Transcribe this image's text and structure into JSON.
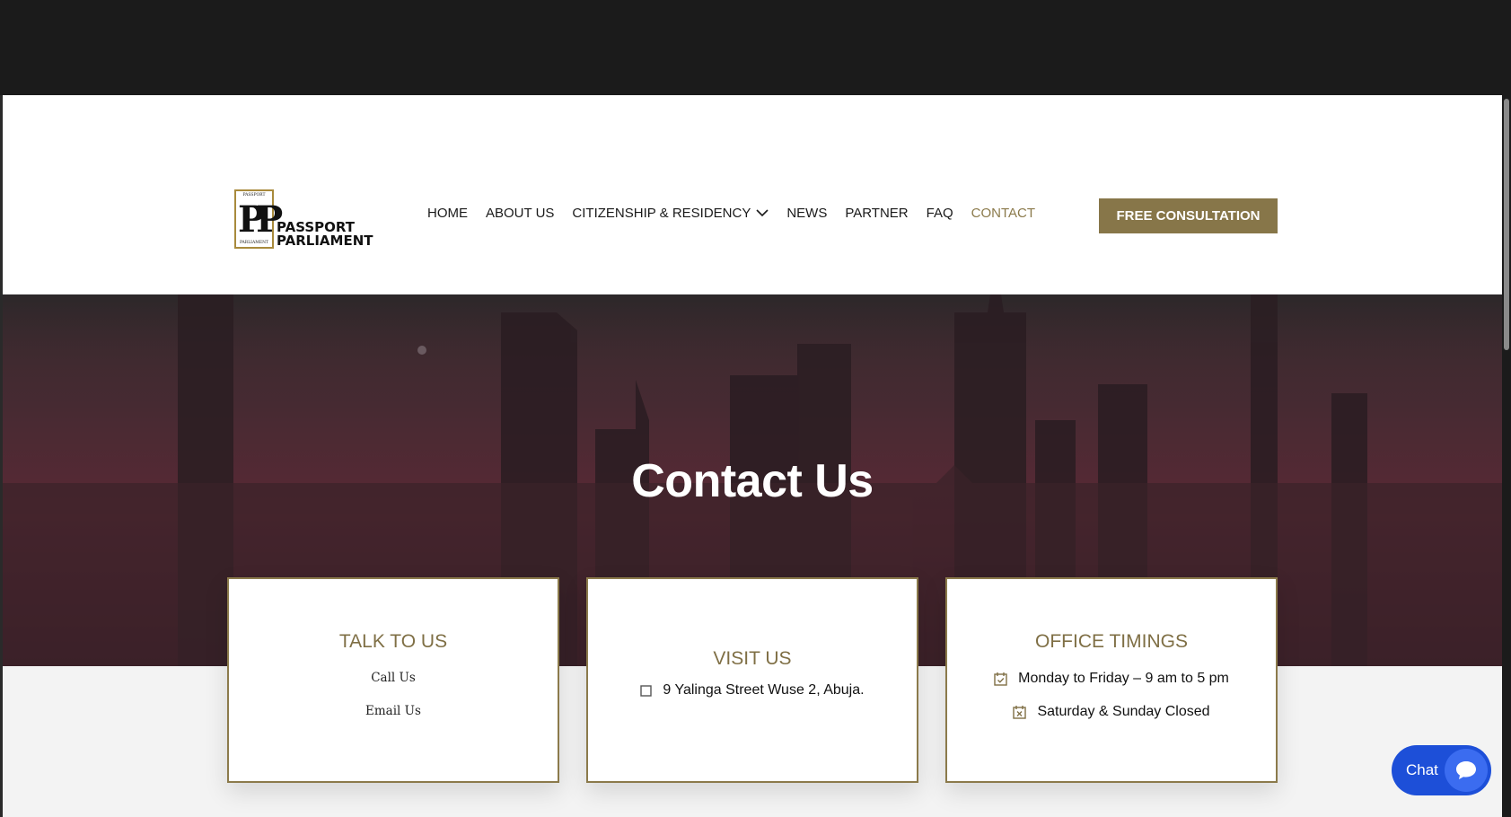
{
  "logo": {
    "top_text": "PASSPORT",
    "bottom_text": "PARLIAMENT",
    "mark": "PP",
    "line1": "PASSPORT",
    "line2": "PARLIAMENT"
  },
  "nav": {
    "items": [
      {
        "label": "HOME"
      },
      {
        "label": "ABOUT US"
      },
      {
        "label": "CITIZENSHIP & RESIDENCY"
      },
      {
        "label": "NEWS"
      },
      {
        "label": "PARTNER"
      },
      {
        "label": "FAQ"
      },
      {
        "label": "CONTACT"
      }
    ],
    "active": "CONTACT",
    "dropdown_icon": "chevron-down-icon"
  },
  "cta": {
    "label": "FREE CONSULTATION"
  },
  "hero": {
    "title": "Contact Us"
  },
  "cards": {
    "talk": {
      "title": "TALK TO US",
      "call": "Call Us",
      "email": "Email Us"
    },
    "visit": {
      "title": "VISIT US",
      "address": "9 Yalinga Street Wuse 2, Abuja.",
      "icon": "square-icon"
    },
    "timings": {
      "title": "OFFICE TIMINGS",
      "weekday": "Monday to Friday – 9 am to 5 pm",
      "weekend": "Saturday & Sunday Closed",
      "weekday_icon": "calendar-check-icon",
      "weekend_icon": "calendar-x-icon"
    }
  },
  "chat": {
    "label": "Chat",
    "icon": "chat-bubble-icon"
  },
  "colors": {
    "accent": "#877649",
    "accent_text": "#7f6f45",
    "topbar": "#1b1b1b",
    "chat": "#1d4fd8"
  }
}
